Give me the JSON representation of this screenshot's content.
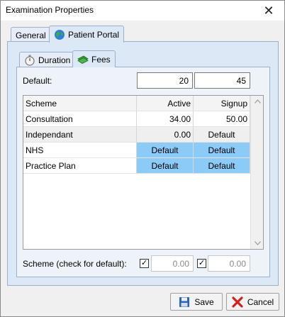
{
  "window": {
    "title": "Examination Properties",
    "close_glyph": "✕"
  },
  "tabs": {
    "outer": [
      {
        "label": "General",
        "active": false
      },
      {
        "label": "Patient Portal",
        "icon": "globe-icon",
        "active": true
      }
    ],
    "inner": [
      {
        "label": "Duration",
        "icon": "stopwatch-icon",
        "active": false
      },
      {
        "label": "Fees",
        "icon": "money-icon",
        "active": true
      }
    ]
  },
  "defaults": {
    "label": "Default:",
    "active_value": "20",
    "signup_value": "45"
  },
  "grid": {
    "columns": [
      "Scheme",
      "Active",
      "Signup"
    ],
    "rows": [
      {
        "scheme": "Consultation",
        "active": "34.00",
        "signup": "50.00"
      },
      {
        "scheme": "Independant",
        "active": "0.00",
        "signup": "Default"
      },
      {
        "scheme": "NHS",
        "active": "Default",
        "signup": "Default"
      },
      {
        "scheme": "Practice Plan",
        "active": "Default",
        "signup": "Default"
      }
    ]
  },
  "scheme_row": {
    "label": "Scheme (check for default):",
    "active_value": "0.00",
    "signup_value": "0.00",
    "check_glyph": "✓"
  },
  "buttons": {
    "save": "Save",
    "cancel": "Cancel"
  },
  "colors": {
    "selection": "#8ccbf7",
    "panel": "#dce8f6",
    "accent_red": "#d42020"
  }
}
